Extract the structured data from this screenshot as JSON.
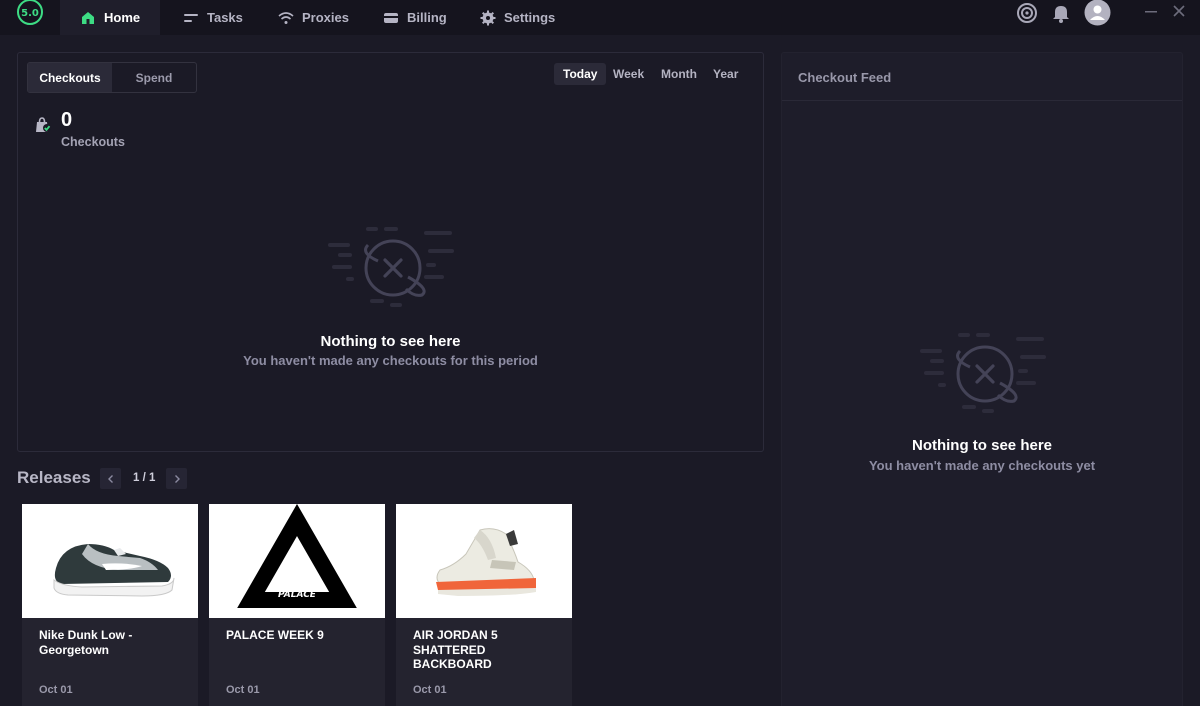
{
  "app": {
    "version": "5.0"
  },
  "nav": {
    "items": [
      {
        "label": "Home",
        "icon": "home-icon",
        "active": true
      },
      {
        "label": "Tasks",
        "icon": "tasks-icon",
        "active": false
      },
      {
        "label": "Proxies",
        "icon": "wifi-icon",
        "active": false
      },
      {
        "label": "Billing",
        "icon": "card-icon",
        "active": false
      },
      {
        "label": "Settings",
        "icon": "gear-icon",
        "active": false
      }
    ]
  },
  "colors": {
    "accent": "#3ddc84",
    "background": "#1b1a26",
    "panel_border": "#2c2b3a"
  },
  "stats": {
    "tabs": [
      "Checkouts",
      "Spend"
    ],
    "active_tab": "Checkouts",
    "periods": [
      "Today",
      "Week",
      "Month",
      "Year"
    ],
    "active_period": "Today",
    "value": "0",
    "label": "Checkouts",
    "empty_title": "Nothing to see here",
    "empty_sub": "You haven't made any checkouts for this period"
  },
  "feed": {
    "title": "Checkout Feed",
    "empty_title": "Nothing to see here",
    "empty_sub": "You haven't made any checkouts yet"
  },
  "releases": {
    "title": "Releases",
    "page": "1 / 1",
    "items": [
      {
        "name": "Nike Dunk Low - Georgetown",
        "date": "Oct 01"
      },
      {
        "name": "PALACE WEEK 9",
        "date": "Oct 01"
      },
      {
        "name": "AIR JORDAN 5 SHATTERED BACKBOARD",
        "date": "Oct 01"
      }
    ]
  }
}
